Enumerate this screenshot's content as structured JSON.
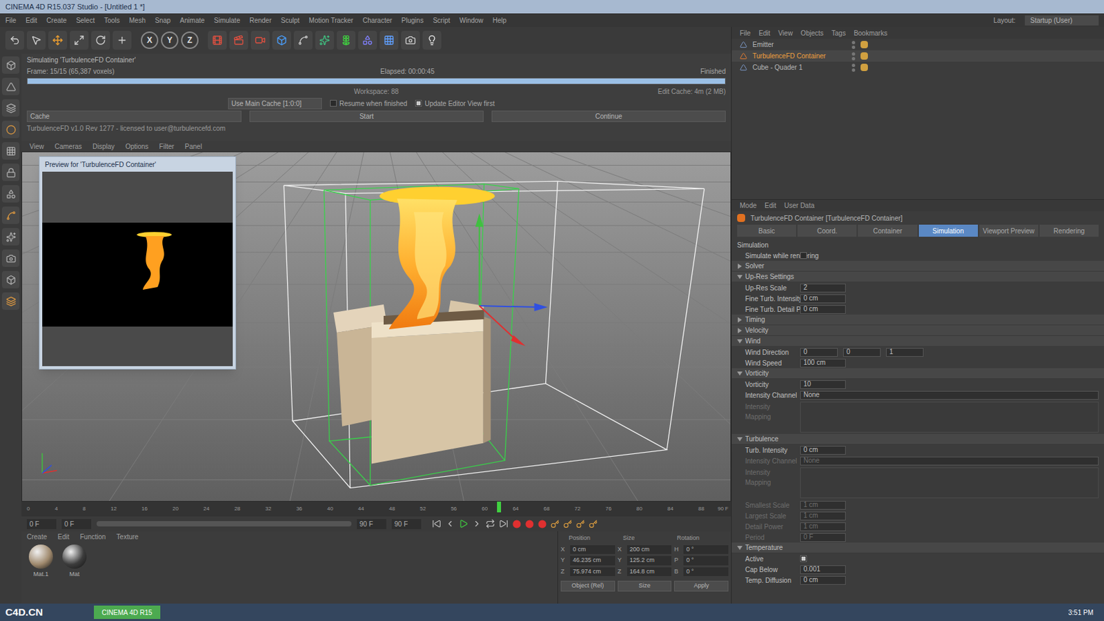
{
  "window": {
    "title": "CINEMA 4D R15.037 Studio - [Untitled 1 *]"
  },
  "menu": [
    "File",
    "Edit",
    "Create",
    "Select",
    "Tools",
    "Mesh",
    "Snap",
    "Animate",
    "Simulate",
    "Render",
    "Sculpt",
    "Motion Tracker",
    "Character",
    "Plugins",
    "Script",
    "Window",
    "Help"
  ],
  "layout": {
    "label": "Layout:",
    "value": "Startup (User)"
  },
  "axis_buttons": [
    "X",
    "Y",
    "Z"
  ],
  "sim_panel": {
    "status": "Simulating 'TurbulenceFD Container'",
    "frame": "Frame: 15/15 (65,387 voxels)",
    "elapsed": "Elapsed: 00:00:45",
    "finished": "Finished",
    "progress": 1.0,
    "workspace": "Workspace: 88",
    "cache": "Edit Cache: 4m (2 MB)",
    "use_cache": "Use Main Cache [1:0:0]",
    "checkboxes": [
      {
        "label": "Resume when finished",
        "checked": false
      },
      {
        "label": "Update Editor View first",
        "checked": true
      }
    ],
    "cache_dropdown": "Cache",
    "buttons": [
      "Start",
      "Continue"
    ],
    "message": "TurbulenceFD v1.0 Rev 1277 - licensed to user@turbulencefd.com"
  },
  "viewport_menu": [
    "View",
    "Cameras",
    "Display",
    "Options",
    "Filter",
    "Panel"
  ],
  "preview": {
    "title": "Preview for 'TurbulenceFD Container'"
  },
  "timeline": {
    "ticks": [
      "0",
      "4",
      "8",
      "12",
      "16",
      "20",
      "24",
      "28",
      "32",
      "36",
      "40",
      "44",
      "48",
      "52",
      "56",
      "60",
      "64",
      "68",
      "72",
      "76",
      "80",
      "84",
      "88"
    ],
    "playhead": 0.73,
    "end_label": "90 F",
    "start_fields": [
      "0 F",
      "0 F"
    ],
    "end_fields": [
      "90 F",
      "90 F"
    ]
  },
  "materials": {
    "menu": [
      "Create",
      "Edit",
      "Function",
      "Texture"
    ],
    "items": [
      {
        "name": "Mat.1",
        "color": "#a08a6e"
      },
      {
        "name": "Mat",
        "color": "#3c3c3c"
      }
    ]
  },
  "coordinates": {
    "headers": [
      "Position",
      "Size",
      "Rotation"
    ],
    "rows": [
      {
        "axis": "X",
        "position": "0 cm",
        "size": "200 cm",
        "rot_axis": "H",
        "rotation": "0 °"
      },
      {
        "axis": "Y",
        "position": "46.235 cm",
        "size": "125.2 cm",
        "rot_axis": "P",
        "rotation": "0 °"
      },
      {
        "axis": "Z",
        "position": "75.974 cm",
        "size": "164.8 cm",
        "rot_axis": "B",
        "rotation": "0 °"
      }
    ],
    "buttons": [
      "Object (Rel)",
      "Size",
      "Apply"
    ]
  },
  "object_manager": {
    "menu": [
      "File",
      "Edit",
      "View",
      "Objects",
      "Tags",
      "Bookmarks"
    ],
    "objects": [
      {
        "name": "Emitter",
        "selected": false
      },
      {
        "name": "TurbulenceFD Container",
        "selected": true
      },
      {
        "name": "Cube - Quader 1",
        "selected": false
      }
    ]
  },
  "attribute_manager": {
    "menu": [
      "Mode",
      "Edit",
      "User Data"
    ],
    "title": "TurbulenceFD Container [TurbulenceFD Container]",
    "tabs": [
      {
        "label": "Basic",
        "selected": false
      },
      {
        "label": "Coord.",
        "selected": false
      },
      {
        "label": "Container",
        "selected": false
      },
      {
        "label": "Simulation",
        "selected": true
      },
      {
        "label": "Viewport Preview",
        "selected": false
      },
      {
        "label": "Rendering",
        "selected": false
      }
    ],
    "rows": [
      {
        "kind": "label",
        "label": "Simulation",
        "disabled": false
      },
      {
        "kind": "checkbox",
        "label": "Simulate while rendering",
        "checked": false,
        "disabled": false
      },
      {
        "kind": "section",
        "label": "Solver",
        "expanded": false,
        "disabled": false
      },
      {
        "kind": "section",
        "label": "Up-Res Settings",
        "expanded": true,
        "disabled": false
      },
      {
        "kind": "field",
        "label": "Up-Res Scale",
        "value": "2",
        "disabled": false
      },
      {
        "kind": "field",
        "label": "Fine Turb. Intensity",
        "value": "0 cm",
        "disabled": false
      },
      {
        "kind": "field",
        "label": "Fine Turb. Detail Power",
        "value": "0 cm",
        "disabled": false
      },
      {
        "kind": "section",
        "label": "Timing",
        "expanded": false,
        "disabled": false
      },
      {
        "kind": "section",
        "label": "Velocity",
        "expanded": false,
        "disabled": false
      },
      {
        "kind": "section",
        "label": "Wind",
        "expanded": true,
        "disabled": false
      },
      {
        "kind": "vector",
        "label": "Wind Direction",
        "values": [
          "0",
          "0",
          "1"
        ],
        "disabled": false
      },
      {
        "kind": "field",
        "label": "Wind Speed",
        "value": "100 cm",
        "disabled": false
      },
      {
        "kind": "section",
        "label": "Vorticity",
        "expanded": true,
        "disabled": false
      },
      {
        "kind": "field",
        "label": "Vorticity",
        "value": "10",
        "disabled": false
      },
      {
        "kind": "dropdown",
        "label": "Intensity Channel",
        "value": "None",
        "disabled": false
      },
      {
        "kind": "graph",
        "label": "Intensity Mapping",
        "disabled": true
      },
      {
        "kind": "section",
        "label": "Turbulence",
        "expanded": true,
        "disabled": false
      },
      {
        "kind": "field",
        "label": "Turb. Intensity",
        "value": "0 cm",
        "disabled": false
      },
      {
        "kind": "dropdown",
        "label": "Intensity Channel",
        "value": "None",
        "disabled": true
      },
      {
        "kind": "graph",
        "label": "Intensity Mapping",
        "disabled": true
      },
      {
        "kind": "field",
        "label": "Smallest Scale",
        "value": "1 cm",
        "disabled": true
      },
      {
        "kind": "field",
        "label": "Largest Scale",
        "value": "1 cm",
        "disabled": true
      },
      {
        "kind": "field",
        "label": "Detail Power",
        "value": "1 cm",
        "disabled": true
      },
      {
        "kind": "field",
        "label": "Period",
        "value": "0 F",
        "disabled": true
      },
      {
        "kind": "section",
        "label": "Temperature",
        "expanded": true,
        "disabled": false
      },
      {
        "kind": "checkbox",
        "label": "Active",
        "checked": true,
        "disabled": false
      },
      {
        "kind": "field",
        "label": "Cap Below",
        "value": "0.001",
        "disabled": false
      },
      {
        "kind": "field",
        "label": "Temp. Diffusion",
        "value": "0 cm",
        "disabled": false
      }
    ]
  },
  "taskbar": {
    "watermark": "C4D.CN",
    "task": "CINEMA 4D R15",
    "clock": "3:51 PM"
  }
}
